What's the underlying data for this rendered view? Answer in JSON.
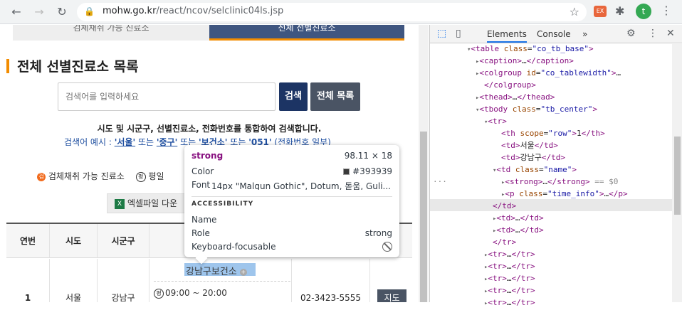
{
  "browser": {
    "url_host": "mohw.go.kr",
    "url_path": "/react/ncov/selclinic04ls.jsp",
    "avatar_letter": "t",
    "ext_label": "EX"
  },
  "page": {
    "tab_left": "검체채취 가능 진료소",
    "tab_right": "전체 선별진료소",
    "title": "전체 선별진료소 목록",
    "search_placeholder": "검색어를 입력하세요",
    "search_button": "검색",
    "list_button": "전체 목록",
    "desc": "시도 및 시군구, 선별진료소, 전화번호를 통합하여 검색합니다.",
    "example_prefix": "검색어 예시 : ",
    "example_1": "'서울'",
    "example_or1": " 또는 ",
    "example_2": "'중구'",
    "example_or2": " 또는 ",
    "example_3": "'보건소'",
    "example_or3": " 또는 ",
    "example_4": "'051'",
    "example_suffix": " (전화번호 일부)",
    "legend_dot": "검",
    "legend_1": "검체채취 가능 진료소",
    "legend_circ": "평",
    "legend_2": "평일",
    "excel_icon": "X",
    "excel_label": "엑셀파일 다운",
    "table": {
      "headers": [
        "연번",
        "시도",
        "시군구"
      ],
      "row": {
        "num": "1",
        "sido": "서울",
        "sigungu": "강남구",
        "name": "강남구보건소",
        "time_circ": "평",
        "time": "09:00 ~ 20:00",
        "phone": "02-3423-5555",
        "map": "지도"
      }
    }
  },
  "tooltip": {
    "tag": "strong",
    "size": "98.11 × 18",
    "color_label": "Color",
    "color_value": "#393939",
    "font_label": "Font",
    "font_value": "14px \"Malgun Gothic\", Dotum, 돋움, Guli...",
    "accessibility": "ACCESSIBILITY",
    "name_label": "Name",
    "role_label": "Role",
    "role_value": "strong",
    "focus_label": "Keyboard-focusable"
  },
  "devtools": {
    "tab_elements": "Elements",
    "tab_console": "Console",
    "more": "»"
  },
  "colors": {
    "accent": "#f28c00",
    "navy": "#1c3464",
    "tab_active": "#3f5680"
  }
}
